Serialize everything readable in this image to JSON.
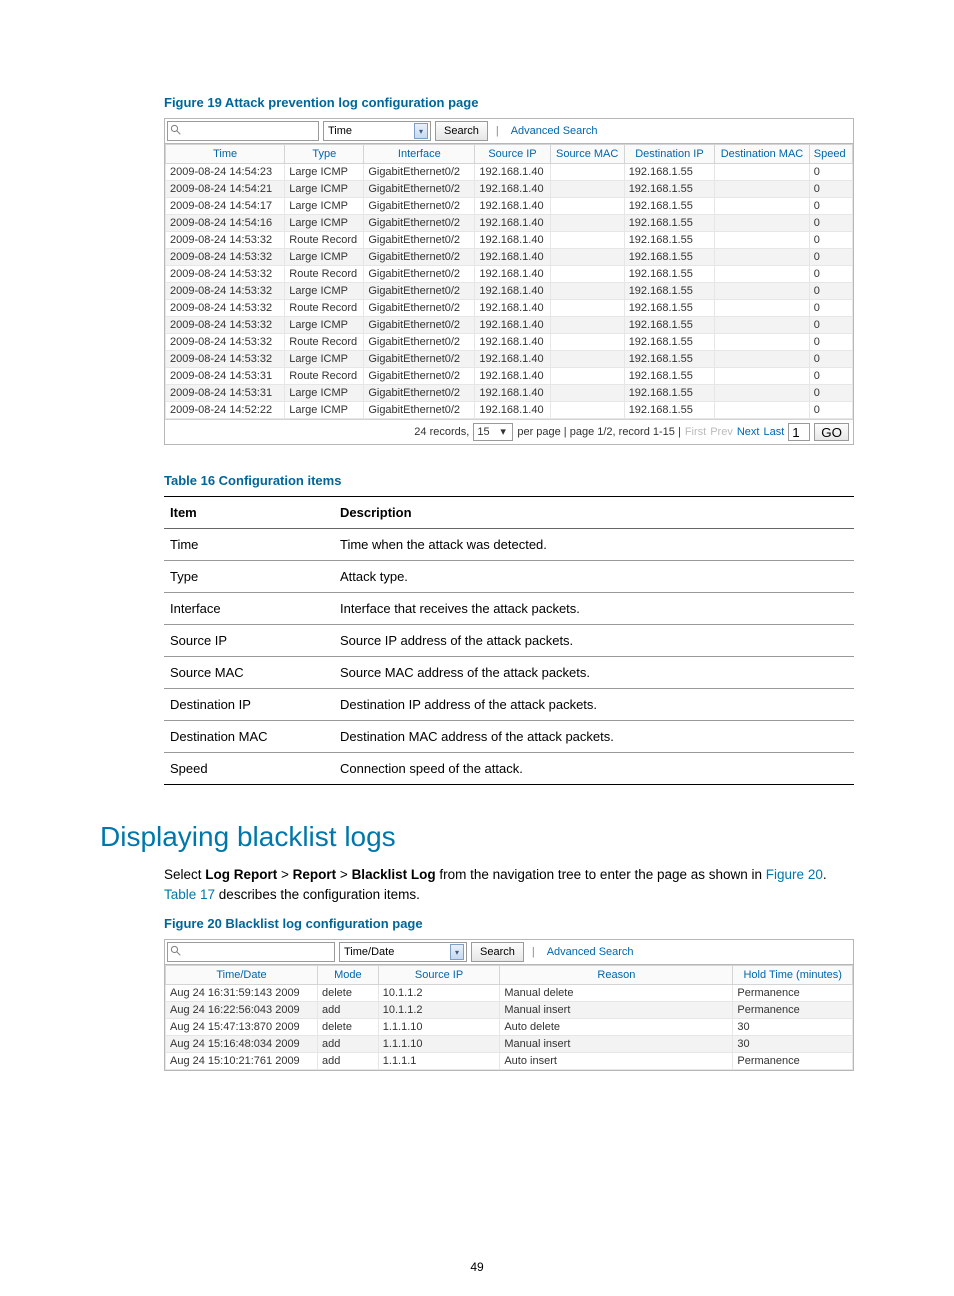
{
  "figure19": {
    "caption": "Figure 19 Attack prevention log configuration page",
    "toolbar": {
      "search_placeholder": "",
      "select_label": "Time",
      "search_btn": "Search",
      "adv_search": "Advanced Search"
    },
    "columns": [
      "Time",
      "Type",
      "Interface",
      "Source IP",
      "Source MAC",
      "Destination IP",
      "Destination MAC",
      "Speed"
    ],
    "rows": [
      {
        "time": "2009-08-24 14:54:23",
        "type": "Large ICMP",
        "if": "GigabitEthernet0/2",
        "sip": "192.168.1.40",
        "smac": "",
        "dip": "192.168.1.55",
        "dmac": "",
        "speed": "0"
      },
      {
        "time": "2009-08-24 14:54:21",
        "type": "Large ICMP",
        "if": "GigabitEthernet0/2",
        "sip": "192.168.1.40",
        "smac": "",
        "dip": "192.168.1.55",
        "dmac": "",
        "speed": "0"
      },
      {
        "time": "2009-08-24 14:54:17",
        "type": "Large ICMP",
        "if": "GigabitEthernet0/2",
        "sip": "192.168.1.40",
        "smac": "",
        "dip": "192.168.1.55",
        "dmac": "",
        "speed": "0"
      },
      {
        "time": "2009-08-24 14:54:16",
        "type": "Large ICMP",
        "if": "GigabitEthernet0/2",
        "sip": "192.168.1.40",
        "smac": "",
        "dip": "192.168.1.55",
        "dmac": "",
        "speed": "0"
      },
      {
        "time": "2009-08-24 14:53:32",
        "type": "Route Record",
        "if": "GigabitEthernet0/2",
        "sip": "192.168.1.40",
        "smac": "",
        "dip": "192.168.1.55",
        "dmac": "",
        "speed": "0"
      },
      {
        "time": "2009-08-24 14:53:32",
        "type": "Large ICMP",
        "if": "GigabitEthernet0/2",
        "sip": "192.168.1.40",
        "smac": "",
        "dip": "192.168.1.55",
        "dmac": "",
        "speed": "0"
      },
      {
        "time": "2009-08-24 14:53:32",
        "type": "Route Record",
        "if": "GigabitEthernet0/2",
        "sip": "192.168.1.40",
        "smac": "",
        "dip": "192.168.1.55",
        "dmac": "",
        "speed": "0"
      },
      {
        "time": "2009-08-24 14:53:32",
        "type": "Large ICMP",
        "if": "GigabitEthernet0/2",
        "sip": "192.168.1.40",
        "smac": "",
        "dip": "192.168.1.55",
        "dmac": "",
        "speed": "0"
      },
      {
        "time": "2009-08-24 14:53:32",
        "type": "Route Record",
        "if": "GigabitEthernet0/2",
        "sip": "192.168.1.40",
        "smac": "",
        "dip": "192.168.1.55",
        "dmac": "",
        "speed": "0"
      },
      {
        "time": "2009-08-24 14:53:32",
        "type": "Large ICMP",
        "if": "GigabitEthernet0/2",
        "sip": "192.168.1.40",
        "smac": "",
        "dip": "192.168.1.55",
        "dmac": "",
        "speed": "0"
      },
      {
        "time": "2009-08-24 14:53:32",
        "type": "Route Record",
        "if": "GigabitEthernet0/2",
        "sip": "192.168.1.40",
        "smac": "",
        "dip": "192.168.1.55",
        "dmac": "",
        "speed": "0"
      },
      {
        "time": "2009-08-24 14:53:32",
        "type": "Large ICMP",
        "if": "GigabitEthernet0/2",
        "sip": "192.168.1.40",
        "smac": "",
        "dip": "192.168.1.55",
        "dmac": "",
        "speed": "0"
      },
      {
        "time": "2009-08-24 14:53:31",
        "type": "Route Record",
        "if": "GigabitEthernet0/2",
        "sip": "192.168.1.40",
        "smac": "",
        "dip": "192.168.1.55",
        "dmac": "",
        "speed": "0"
      },
      {
        "time": "2009-08-24 14:53:31",
        "type": "Large ICMP",
        "if": "GigabitEthernet0/2",
        "sip": "192.168.1.40",
        "smac": "",
        "dip": "192.168.1.55",
        "dmac": "",
        "speed": "0"
      },
      {
        "time": "2009-08-24 14:52:22",
        "type": "Large ICMP",
        "if": "GigabitEthernet0/2",
        "sip": "192.168.1.40",
        "smac": "",
        "dip": "192.168.1.55",
        "dmac": "",
        "speed": "0"
      }
    ],
    "pager": {
      "records_text": "24 records,",
      "per_value": "15",
      "per_page_text": "per page | page 1/2, record 1-15 |",
      "first": "First",
      "prev": "Prev",
      "next": "Next",
      "last": "Last",
      "page_value": "1",
      "go": "GO"
    }
  },
  "table16": {
    "caption": "Table 16 Configuration items",
    "header": {
      "item": "Item",
      "desc": "Description"
    },
    "rows": [
      {
        "item": "Time",
        "desc": "Time when the attack was detected."
      },
      {
        "item": "Type",
        "desc": "Attack type."
      },
      {
        "item": "Interface",
        "desc": "Interface that receives the attack packets."
      },
      {
        "item": "Source IP",
        "desc": "Source IP address of the attack packets."
      },
      {
        "item": "Source MAC",
        "desc": "Source MAC address of the attack packets."
      },
      {
        "item": "Destination IP",
        "desc": "Destination IP address of the attack packets."
      },
      {
        "item": "Destination MAC",
        "desc": "Destination MAC address of the attack packets."
      },
      {
        "item": "Speed",
        "desc": "Connection speed of the attack."
      }
    ]
  },
  "heading_blacklist": "Displaying blacklist logs",
  "para": {
    "p1a": "Select ",
    "b1": "Log Report",
    "gt1": " > ",
    "b2": "Report",
    "gt2": " > ",
    "b3": "Blacklist Log",
    "p1b": " from the navigation tree to enter the page as shown in ",
    "link1": "Figure 20",
    "period": ". ",
    "link2": "Table 17",
    "p1c": " describes the configuration items."
  },
  "figure20": {
    "caption": "Figure 20 Blacklist log configuration page",
    "toolbar": {
      "search_placeholder": "",
      "select_label": "Time/Date",
      "search_btn": "Search",
      "adv_search": "Advanced Search"
    },
    "columns": [
      "Time/Date",
      "Mode",
      "Source IP",
      "Reason",
      "Hold Time (minutes)"
    ],
    "rows": [
      {
        "td": "Aug 24 16:31:59:143 2009",
        "mode": "delete",
        "sip": "10.1.1.2",
        "reason": "Manual delete",
        "hold": "Permanence"
      },
      {
        "td": "Aug 24 16:22:56:043 2009",
        "mode": "add",
        "sip": "10.1.1.2",
        "reason": "Manual insert",
        "hold": "Permanence"
      },
      {
        "td": "Aug 24 15:47:13:870 2009",
        "mode": "delete",
        "sip": "1.1.1.10",
        "reason": "Auto delete",
        "hold": "30"
      },
      {
        "td": "Aug 24 15:16:48:034 2009",
        "mode": "add",
        "sip": "1.1.1.10",
        "reason": "Manual insert",
        "hold": "30"
      },
      {
        "td": "Aug 24 15:10:21:761 2009",
        "mode": "add",
        "sip": "1.1.1.1",
        "reason": "Auto insert",
        "hold": "Permanence"
      }
    ]
  },
  "page_number": "49"
}
